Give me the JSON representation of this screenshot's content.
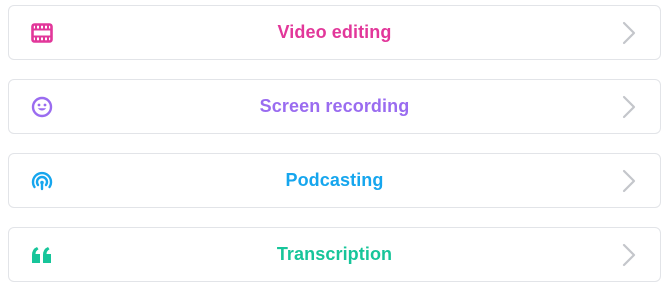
{
  "items": [
    {
      "label": "Video editing",
      "icon": "film-icon",
      "color": "#e2379a"
    },
    {
      "label": "Screen recording",
      "icon": "smiley-icon",
      "color": "#9a6cf0"
    },
    {
      "label": "Podcasting",
      "icon": "podcast-icon",
      "color": "#16a6ee"
    },
    {
      "label": "Transcription",
      "icon": "quote-icon",
      "color": "#17c59a"
    }
  ],
  "chevron_color": "#c4c6cb"
}
